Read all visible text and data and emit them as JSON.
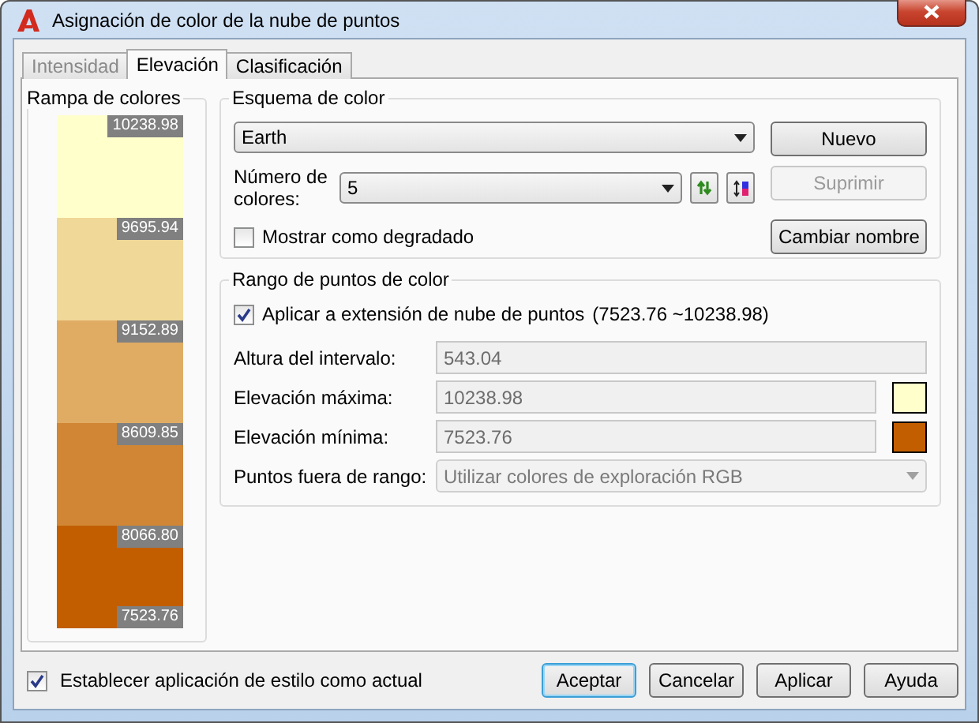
{
  "window": {
    "title": "Asignación de color de la nube de puntos"
  },
  "tabs": [
    {
      "label": "Intensidad",
      "selected": false,
      "disabled": true
    },
    {
      "label": "Elevación",
      "selected": true,
      "disabled": false
    },
    {
      "label": "Clasificación",
      "selected": false,
      "disabled": false
    }
  ],
  "color_ramp": {
    "title": "Rampa de colores",
    "bands": [
      {
        "color": "#ffffcc"
      },
      {
        "color": "#f0d898"
      },
      {
        "color": "#e0ac64"
      },
      {
        "color": "#d08634"
      },
      {
        "color": "#c25e00"
      }
    ],
    "labels": [
      "10238.98",
      "9695.94",
      "9152.89",
      "8609.85",
      "8066.80",
      "7523.76"
    ]
  },
  "color_scheme": {
    "title": "Esquema de color",
    "scheme": {
      "value": "Earth"
    },
    "count_label": "Número de colores:",
    "count": {
      "value": "5"
    },
    "show_gradient": {
      "label": "Mostrar como degradado",
      "checked": false
    },
    "buttons": [
      {
        "label": "Nuevo",
        "disabled": false
      },
      {
        "label": "Suprimir",
        "disabled": true
      },
      {
        "label": "Cambiar nombre",
        "disabled": false
      }
    ]
  },
  "color_range": {
    "title": "Rango de puntos de color",
    "apply_extent": {
      "label": "Aplicar a extensión de nube de puntos",
      "range": "(7523.76 ~10238.98)",
      "checked": true
    },
    "fields": [
      {
        "label": "Altura del intervalo:",
        "value": "543.04",
        "disabled": true
      },
      {
        "label": "Elevación máxima:",
        "value": "10238.98",
        "disabled": true,
        "color": "#ffffcc"
      },
      {
        "label": "Elevación mínima:",
        "value": "7523.76",
        "disabled": true,
        "color": "#c25e00"
      }
    ],
    "out_of_range": {
      "label": "Puntos fuera de rango:",
      "value": "Utilizar colores de exploración RGB",
      "disabled": true
    }
  },
  "set_current": {
    "label": "Establecer aplicación de estilo como actual",
    "checked": true
  },
  "buttons": [
    {
      "label": "Aceptar",
      "default": true
    },
    {
      "label": "Cancelar",
      "default": false
    },
    {
      "label": "Aplicar",
      "default": false
    },
    {
      "label": "Ayuda",
      "default": false
    }
  ]
}
